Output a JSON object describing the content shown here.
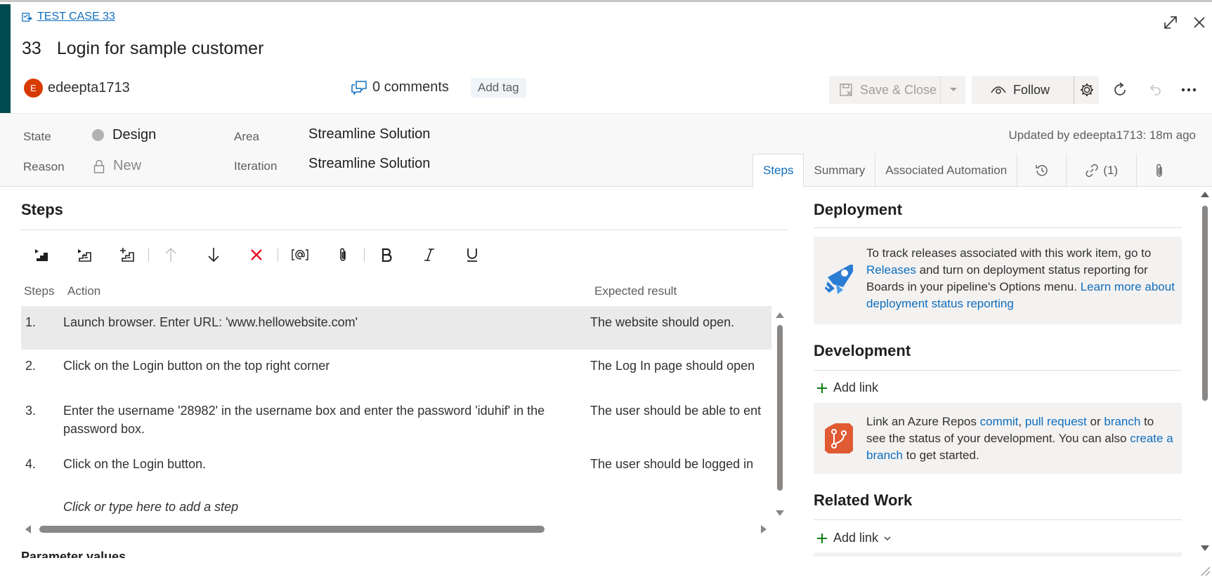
{
  "work_item": {
    "type_label": "TEST CASE 33",
    "id": "33",
    "title": "Login for sample customer",
    "owner": {
      "initial": "E",
      "name": "edeepta1713"
    },
    "comments": "0 comments",
    "add_tag": "Add tag"
  },
  "toolbar": {
    "save_close": "Save & Close",
    "follow": "Follow"
  },
  "fields": {
    "state_label": "State",
    "state_value": "Design",
    "reason_label": "Reason",
    "reason_value": "New",
    "area_label": "Area",
    "area_value": "Streamline Solution",
    "iteration_label": "Iteration",
    "iteration_value": "Streamline Solution",
    "updated": "Updated by edeepta1713: 18m ago"
  },
  "tabs": {
    "steps": "Steps",
    "summary": "Summary",
    "associated_automation": "Associated Automation",
    "links_count": "(1)"
  },
  "steps_panel": {
    "title": "Steps",
    "col_steps": "Steps",
    "col_action": "Action",
    "col_expected": "Expected result",
    "rows": [
      {
        "num": "1.",
        "action": "Launch browser. Enter URL: 'www.hellowebsite.com'",
        "expected": "The website should open."
      },
      {
        "num": "2.",
        "action": "Click on the Login button on the top right corner",
        "expected": "The Log In page should open"
      },
      {
        "num": "3.",
        "action": "Enter the username '28982' in the username box and enter the password 'iduhif' in the password box.",
        "expected": "The user should be able to ent"
      },
      {
        "num": "4.",
        "action": "Click on the Login button.",
        "expected": "The user should be logged in"
      }
    ],
    "add_step_placeholder": "Click or type here to add a step",
    "param_values": "Parameter values"
  },
  "deployment": {
    "title": "Deployment",
    "text_1": "To track releases associated with this work item, go to",
    "link_releases": "Releases",
    "text_2": "and turn on deployment status reporting for Boards in your pipeline's Options menu.",
    "link_learn_1": "Learn more",
    "link_learn_2": "about deployment status reporting"
  },
  "development": {
    "title": "Development",
    "add_link": "Add link",
    "text_1": "Link an Azure Repos",
    "link_commit": "commit",
    "comma": ",",
    "link_pr": "pull request",
    "or": "or",
    "link_branch": "branch",
    "text_2": "to see the status of your development. You can also",
    "link_create_branch": "create a branch",
    "text_3": "to get started."
  },
  "related_work": {
    "title": "Related Work",
    "add_link": "Add link"
  },
  "colors": {
    "accent_bar": "#004b50",
    "link": "#106ebe",
    "avatar": "#d83b01",
    "delete_red": "#e81123",
    "add_green": "#107c10",
    "pipeline_blue": "#2b7cd3",
    "repo_orange": "#e05a33"
  }
}
